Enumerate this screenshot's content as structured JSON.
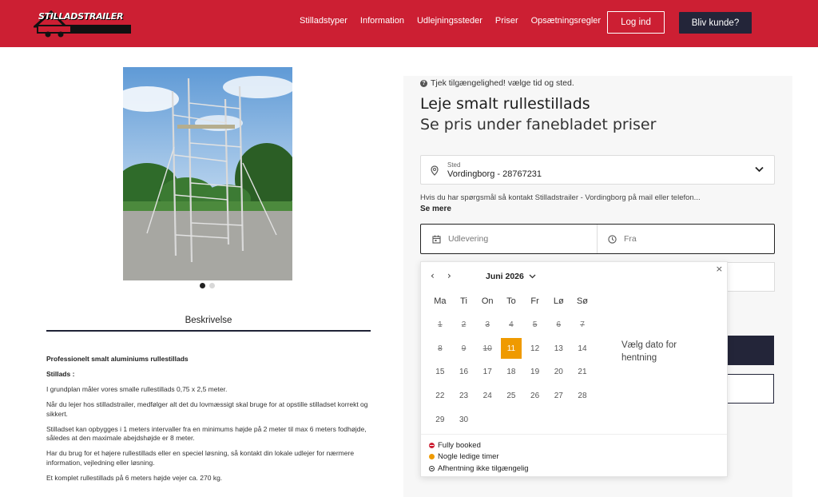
{
  "header": {
    "logo_text": "STILLADSTRAILER",
    "nav": [
      "Stilladstyper",
      "Information",
      "Udlejningssteder",
      "Priser",
      "Opsætningsregler"
    ],
    "login_label": "Log ind",
    "signup_label": "Bliv kunde?",
    "colors": {
      "bar": "#cc1f33",
      "button_dark": "#232539"
    }
  },
  "product": {
    "image_alt": "Smalt aluminiums rullestillads",
    "tab_label": "Beskrivelse",
    "description": [
      "Professionelt smalt aluminiums rullestillads",
      "Stillads :",
      "I grundplan måler vores smalle rullestillads 0,75 x 2,5 meter.",
      "Når du lejer hos stilladstrailer, medfølger alt det du lovmæssigt skal bruge for at opstille stilladset korrekt og sikkert.",
      "Stilladset kan opbygges i 1 meters intervaller fra en minimums højde på 2 meter til max 6 meters fodhøjde, således at den maximale abejdshøjde er 8 meter.",
      "Har du brug for et højere rullestillads eller en speciel løsning, så kontakt din lokale udlejer for nærmere information, vejledning eller løsning.",
      "Et komplet rullestillads på 6 meters højde vejer ca. 270 kg."
    ]
  },
  "booking": {
    "hint": "Tjek tilgængelighed! vælge tid og sted.",
    "title": "Leje smalt rullestillads",
    "subtitle": "Se pris under fanebladet priser",
    "location_label": "Sted",
    "location_value": "Vordingborg - 28767231",
    "contact_text": "Hvis du har spørgsmål så kontakt Stilladstrailer - Vordingborg på mail eller telefon...",
    "see_more": "Se mere",
    "pickup_placeholder": "Udlevering",
    "from_placeholder": "Fra"
  },
  "calendar": {
    "month_label": "Juni 2026",
    "weekdays": [
      "Ma",
      "Ti",
      "On",
      "To",
      "Fr",
      "Lø",
      "Sø"
    ],
    "days": [
      "1",
      "2",
      "3",
      "4",
      "5",
      "6",
      "7",
      "8",
      "9",
      "10",
      "11",
      "12",
      "13",
      "14",
      "15",
      "16",
      "17",
      "18",
      "19",
      "20",
      "21",
      "22",
      "23",
      "24",
      "25",
      "26",
      "27",
      "28",
      "29",
      "30"
    ],
    "selected_day": "11",
    "side_text": "Vælg dato for hentning",
    "legend": [
      "Fully booked",
      "Nogle ledige timer",
      "Afhentning ikke tilgængelig"
    ],
    "accent_color": "#ef9a00"
  }
}
